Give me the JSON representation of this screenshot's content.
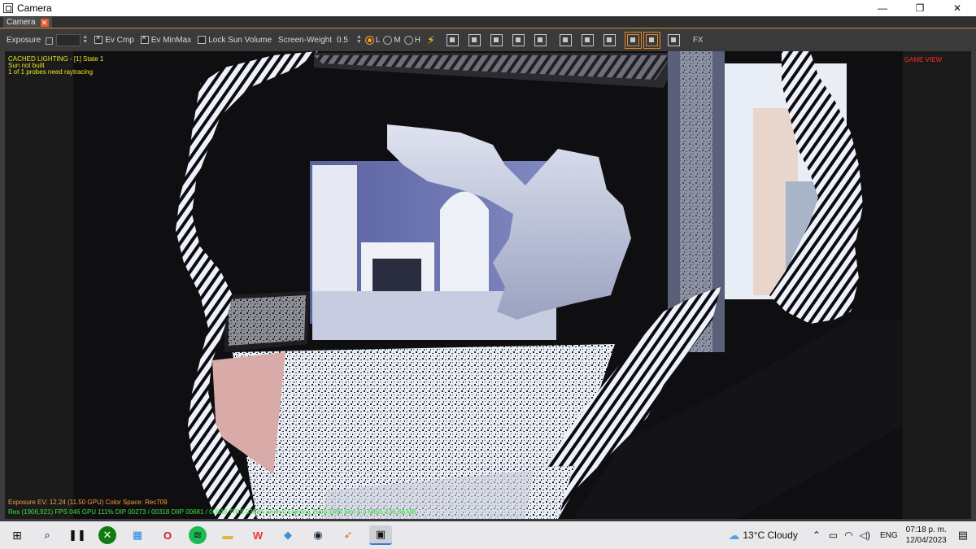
{
  "window": {
    "title": "Camera",
    "minimize": "—",
    "restore": "❐",
    "close": "✕"
  },
  "tab": {
    "label": "Camera",
    "close": "✕"
  },
  "toolbar": {
    "exposure_label": "Exposure",
    "ev_cmp_label": "Ev Cmp",
    "ev_minmax_label": "Ev MinMax",
    "lock_sun_label": "Lock Sun Volume",
    "screen_weight_label": "Screen-Weight",
    "screen_weight_value": "0.5",
    "quality_l": "L",
    "quality_m": "M",
    "quality_h": "H",
    "fx_label": "FX"
  },
  "overlay": {
    "lighting_line1": "CACHED LIGHTING - [1] State 1",
    "lighting_line2": "Sun not built",
    "lighting_line3": "1 of 1 probes need raytracing",
    "game_view": "GAME VIEW",
    "exposure_line": "Exposure EV: 12.24 (11.50 GPU)  Color Space: Rec709",
    "stats_line": "Res (1906,921)   FPS 046   GPU 111%   DIP 00273 / 00318   DIIP 00681 / 00846   TRIS 0303K   Anim 0  Lighting 2990.1MB   Stm 5.4 MB/s 126.68 MB"
  },
  "taskbar": {
    "weather": "13°C  Cloudy",
    "language": "ENG",
    "time": "07:18 p. m.",
    "date": "12/04/2023"
  }
}
